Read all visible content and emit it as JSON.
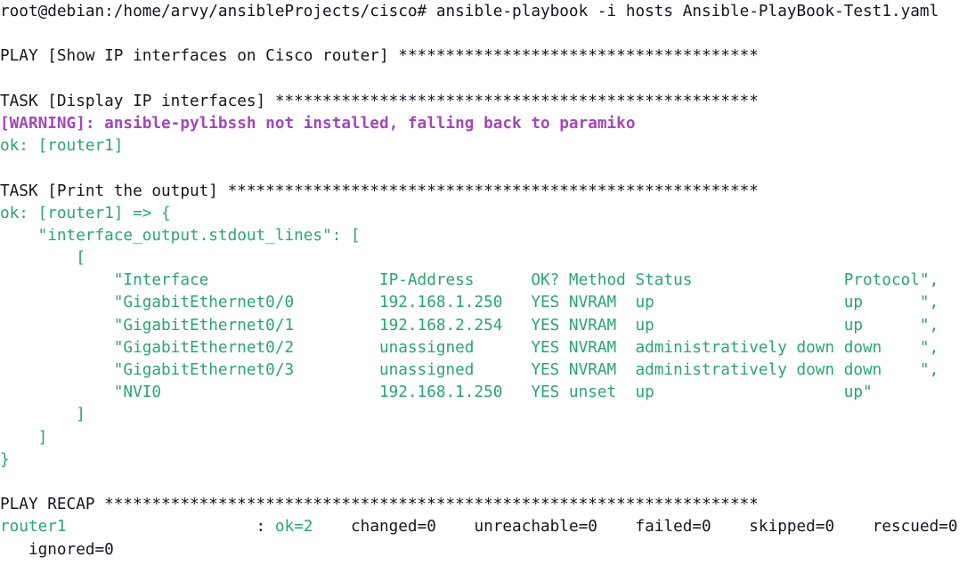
{
  "colors": {
    "default": "#171421",
    "green": "#2aa56f",
    "purple": "#a347ba"
  },
  "lines": [
    {
      "segments": [
        {
          "text": "root@debian:/home/arvy/ansibleProjects/cisco# ansible-playbook -i hosts Ansible-PlayBook-Test1.yaml",
          "color": "default"
        }
      ]
    },
    {
      "segments": []
    },
    {
      "segments": [
        {
          "text": "PLAY [Show IP interfaces on Cisco router] **************************************",
          "color": "default"
        }
      ]
    },
    {
      "segments": []
    },
    {
      "segments": [
        {
          "text": "TASK [Display IP interfaces] ***************************************************",
          "color": "default"
        }
      ]
    },
    {
      "segments": [
        {
          "text": "[WARNING]: ansible-pylibssh not installed, falling back to paramiko",
          "color": "purple"
        }
      ]
    },
    {
      "segments": [
        {
          "text": "ok: [router1]",
          "color": "green"
        }
      ]
    },
    {
      "segments": []
    },
    {
      "segments": [
        {
          "text": "TASK [Print the output] ********************************************************",
          "color": "default"
        }
      ]
    },
    {
      "segments": [
        {
          "text": "ok: [router1] => {",
          "color": "green"
        }
      ]
    },
    {
      "segments": [
        {
          "text": "    \"interface_output.stdout_lines\": [",
          "color": "green"
        }
      ]
    },
    {
      "segments": [
        {
          "text": "        [",
          "color": "green"
        }
      ]
    },
    {
      "segments": [
        {
          "text": "            \"Interface                  IP-Address      OK? Method Status                Protocol\",",
          "color": "green"
        }
      ]
    },
    {
      "segments": [
        {
          "text": "            \"GigabitEthernet0/0         192.168.1.250   YES NVRAM  up                    up      \",",
          "color": "green"
        }
      ]
    },
    {
      "segments": [
        {
          "text": "            \"GigabitEthernet0/1         192.168.2.254   YES NVRAM  up                    up      \",",
          "color": "green"
        }
      ]
    },
    {
      "segments": [
        {
          "text": "            \"GigabitEthernet0/2         unassigned      YES NVRAM  administratively down down    \",",
          "color": "green"
        }
      ]
    },
    {
      "segments": [
        {
          "text": "            \"GigabitEthernet0/3         unassigned      YES NVRAM  administratively down down    \",",
          "color": "green"
        }
      ]
    },
    {
      "segments": [
        {
          "text": "            \"NVI0                       192.168.1.250   YES unset  up                    up\"",
          "color": "green"
        }
      ]
    },
    {
      "segments": [
        {
          "text": "        ]",
          "color": "green"
        }
      ]
    },
    {
      "segments": [
        {
          "text": "    ]",
          "color": "green"
        }
      ]
    },
    {
      "segments": [
        {
          "text": "}",
          "color": "green"
        }
      ]
    },
    {
      "segments": []
    },
    {
      "segments": [
        {
          "text": "PLAY RECAP *********************************************************************",
          "color": "default"
        }
      ]
    },
    {
      "segments": [
        {
          "text": "router1",
          "color": "green"
        },
        {
          "text": "                    : ",
          "color": "default"
        },
        {
          "text": "ok=2",
          "color": "green"
        },
        {
          "text": "    changed=0    unreachable=0    failed=0    skipped=0    rescued=0",
          "color": "default"
        }
      ]
    },
    {
      "segments": [
        {
          "text": "   ignored=0",
          "color": "default"
        }
      ]
    }
  ]
}
